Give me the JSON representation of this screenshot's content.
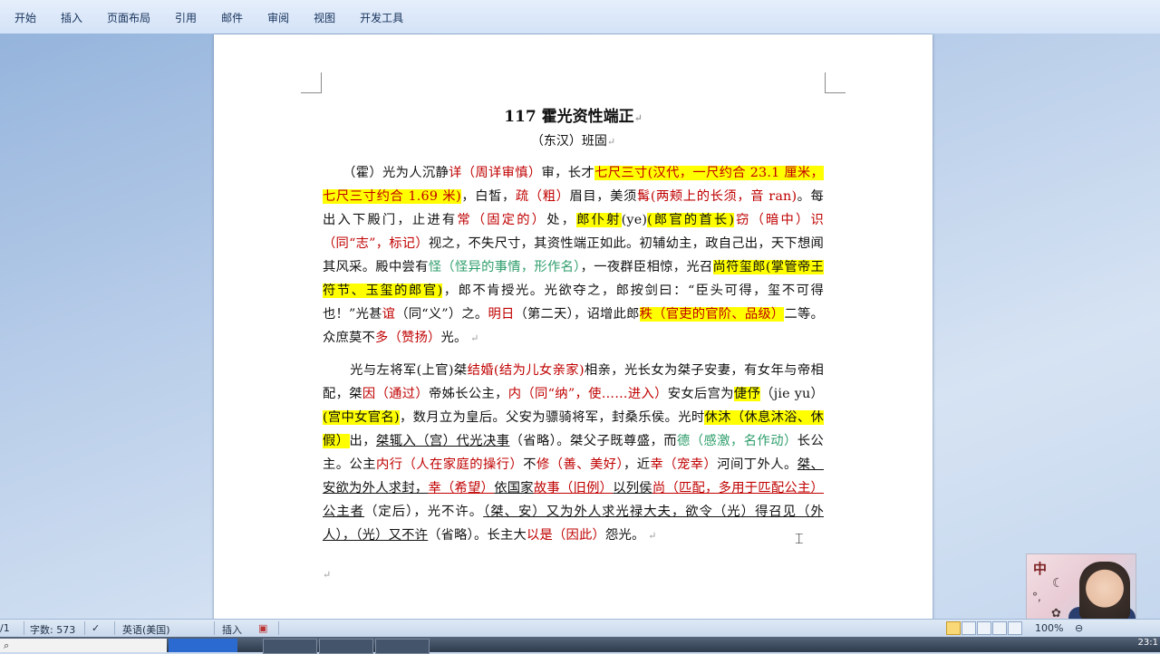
{
  "ribbon": {
    "tabs": [
      "开始",
      "插入",
      "页面布局",
      "引用",
      "邮件",
      "审阅",
      "视图",
      "开发工具"
    ]
  },
  "document": {
    "title": "117 霍光资性端正",
    "author": "（东汉）班固",
    "paragraph1": [
      {
        "t": "（霍）光为人沉静"
      },
      {
        "t": "详（周详审慎）",
        "c": "red"
      },
      {
        "t": "审，长才"
      },
      {
        "t": "七尺三寸(汉代，一尺约合 23.1 厘米，七尺三寸约合 1.69 米)",
        "c": "red",
        "h": true
      },
      {
        "t": "，白皙，"
      },
      {
        "t": "疏（粗）",
        "c": "red"
      },
      {
        "t": "眉目，美须"
      },
      {
        "t": "髯(两颊上的长须，音 ran)",
        "c": "red"
      },
      {
        "t": "。每出入下殿门，止进有"
      },
      {
        "t": "常（固定的）",
        "c": "red"
      },
      {
        "t": "处，"
      },
      {
        "t": "郎仆射",
        "h": true
      },
      {
        "t": "(ye)"
      },
      {
        "t": "(郎官的首长)",
        "h": true
      },
      {
        "t": "窃（暗中）识（同“志”，标记）",
        "c": "red"
      },
      {
        "t": "视之，不失尺寸，其资性端正如此。初辅幼主，政自己出，天下想闻其风采。殿中尝有"
      },
      {
        "t": "怪（怪异的事情，形作名）",
        "c": "green"
      },
      {
        "t": "，一夜群臣相惊，光召"
      },
      {
        "t": "尚符玺郎(掌管帝王符节、玉玺的郎官)",
        "h": true
      },
      {
        "t": "，郎不肯授光。光欲夺之，郎按剑曰：“臣头可得，玺不可得也！”光甚"
      },
      {
        "t": "谊",
        "c": "red"
      },
      {
        "t": "（同“义”）之。"
      },
      {
        "t": "明日",
        "c": "red"
      },
      {
        "t": "（第二天），诏增此郎"
      },
      {
        "t": "秩（官吏的官阶、品级）",
        "c": "red",
        "h": true
      },
      {
        "t": "二等。众庶莫不"
      },
      {
        "t": "多（赞扬）",
        "c": "red"
      },
      {
        "t": "光。"
      }
    ],
    "paragraph2": [
      {
        "t": "光与左将军(上官)桀"
      },
      {
        "t": "结婚(结为儿女亲家)",
        "c": "red"
      },
      {
        "t": "相亲，光长女为桀子安妻，有女年与帝相配，桀"
      },
      {
        "t": "因（通过）",
        "c": "red"
      },
      {
        "t": "帝姊长公主，"
      },
      {
        "t": "内（同“纳”，使……进入）",
        "c": "red"
      },
      {
        "t": "安女后宫为"
      },
      {
        "t": "倢伃",
        "h": true
      },
      {
        "t": "（jie yu）"
      },
      {
        "t": "(宫中女官名)",
        "h": true
      },
      {
        "t": "，数月立为皇后。父安为骠骑将军，封桑乐侯。光时"
      },
      {
        "t": "休沐（休息沐浴、休假）",
        "h": true
      },
      {
        "t": "出，"
      },
      {
        "t": "桀辄入（宫）代光决事",
        "u": true
      },
      {
        "t": "（省略）。桀父子既尊盛，而"
      },
      {
        "t": "德（感激，名作动）",
        "c": "green"
      },
      {
        "t": "长公主。公主"
      },
      {
        "t": "内行（人在家庭的操行）",
        "c": "red"
      },
      {
        "t": "不"
      },
      {
        "t": "修（善、美好）",
        "c": "red"
      },
      {
        "t": "，近"
      },
      {
        "t": "幸（宠幸）",
        "c": "red"
      },
      {
        "t": "河间丁外人。"
      },
      {
        "t": "桀、安欲为外人求封，",
        "u": true
      },
      {
        "t": "幸（希望）",
        "c": "red",
        "u": true
      },
      {
        "t": "依国家",
        "u": true
      },
      {
        "t": "故事（旧例）",
        "c": "red",
        "u": true
      },
      {
        "t": "以列侯",
        "u": true
      },
      {
        "t": "尚（匹配，多用于匹配公主）",
        "c": "red",
        "u": true
      },
      {
        "t": "公主者",
        "u": true
      },
      {
        "t": "（定后），光不许。"
      },
      {
        "t": "（桀、安）又为外人求光禄大夫，欲令（光）得召见（外人），（光）又不许",
        "u": true
      },
      {
        "t": "（省略）。长主大"
      },
      {
        "t": "以是（因此）",
        "c": "red"
      },
      {
        "t": "怨光。"
      }
    ]
  },
  "status": {
    "page": "/1",
    "word_count": "字数: 573",
    "language": "英语(美国)",
    "mode": "插入",
    "zoom": "100%"
  },
  "taskbar": {
    "clock": "23:1"
  },
  "webcam": {
    "char": "中"
  }
}
